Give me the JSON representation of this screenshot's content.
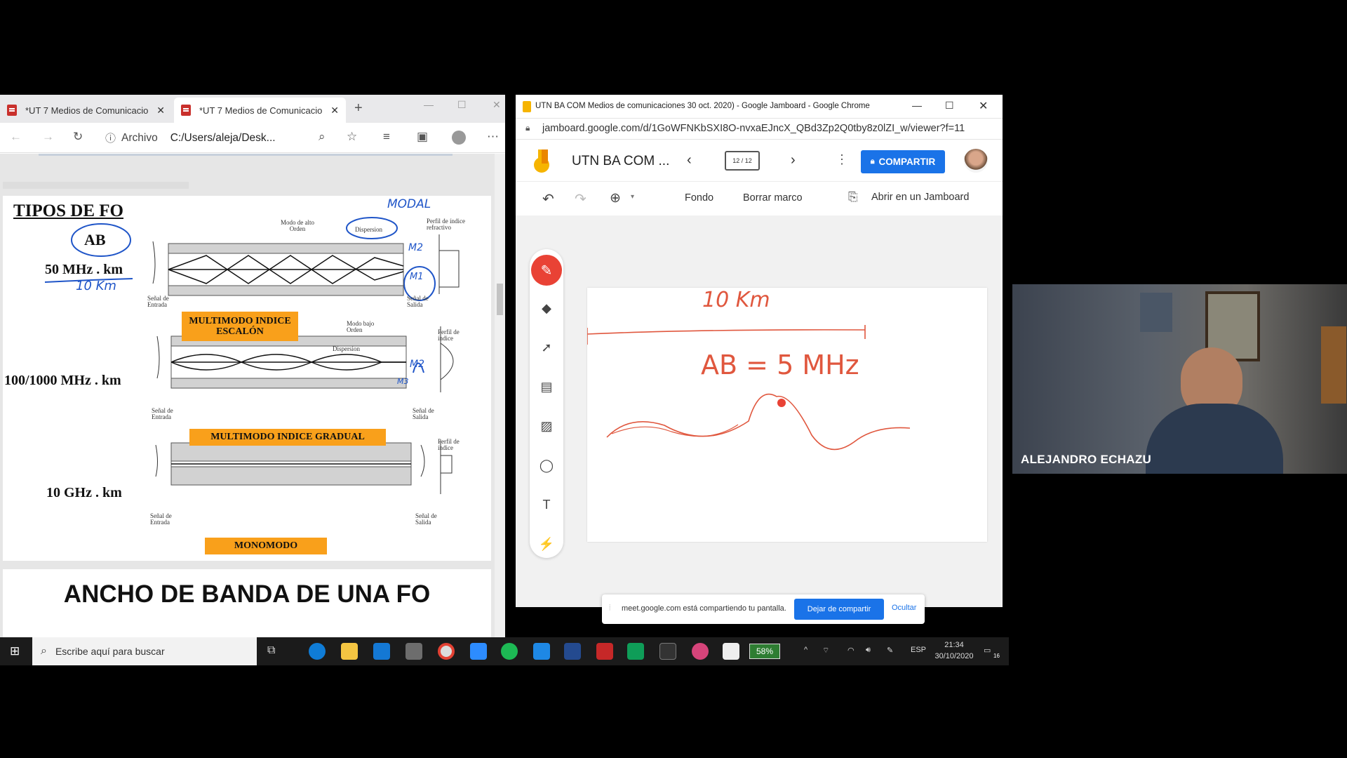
{
  "edge": {
    "tabs": [
      {
        "title": "*UT 7 Medios de Comunicacio"
      },
      {
        "title": "*UT 7 Medios de Comunicacio"
      }
    ],
    "address_label": "Archivo",
    "address": "C:/Users/aleja/Desk...",
    "pdf": {
      "title": "TIPOS DE FO",
      "hw_ab": "AB",
      "hw_modal": "MODAL",
      "hw_10km": "10 Km",
      "hw_m2": "M2",
      "hw_m1": "M1",
      "hw_m2b": "M2",
      "hw_m3": "M3",
      "rate1": "50 MHz . km",
      "rate2": "100/1000 MHz . km",
      "rate3": "10 GHz . km",
      "box1": "MULTIMODO INDICE ESCALÓN",
      "box2": "MULTIMODO INDICE GRADUAL",
      "box3": "MONOMODO",
      "lbl_alto": "Modo de alto Orden",
      "lbl_dispersion": "Dispersion",
      "lbl_dispersion2": "Dispersion",
      "lbl_perfil": "Perfil de índice refractivo",
      "lbl_perfil2": "Perfil de índice",
      "lbl_perfil3": "Perfil de índice",
      "lbl_bajo": "Modo bajo Orden",
      "lbl_entrada": "Señal de Entrada",
      "lbl_salida": "Señal de Salida",
      "page2_title": "ANCHO DE BANDA DE UNA FO"
    }
  },
  "chrome": {
    "title": "UTN BA COM Medios de comunicaciones 30 oct. 2020) - Google Jamboard - Google Chrome",
    "url": "jamboard.google.com/d/1GoWFNKbSXI8O-nvxaEJncX_QBd3Zp2Q0tby8z0lZI_w/viewer?f=11",
    "jam_title": "UTN BA COM ...",
    "frame_counter": "12 / 12",
    "share_label": "COMPARTIR",
    "toolbar": {
      "background": "Fondo",
      "clear_frame": "Borrar marco",
      "open_in": "Abrir en un Jamboard"
    },
    "canvas": {
      "hw_distance": "10 Km",
      "hw_bandwidth": "AB = 5 MHz"
    },
    "share_bar": {
      "message": "meet.google.com está compartiendo tu pantalla.",
      "stop": "Dejar de compartir",
      "hide": "Ocultar"
    }
  },
  "taskbar": {
    "search_placeholder": "Escribe aquí para buscar",
    "battery": "58%",
    "language": "ESP",
    "time": "21:34",
    "date": "30/10/2020",
    "notifications": "16"
  },
  "video": {
    "participant_name": "ALEJANDRO ECHAZU"
  },
  "colors": {
    "jam_red": "#e94235",
    "share_blue": "#1a73e8",
    "pdf_orange": "#f9a01b",
    "ink_blue": "#1f55c8",
    "ink_red": "#e0573e"
  }
}
